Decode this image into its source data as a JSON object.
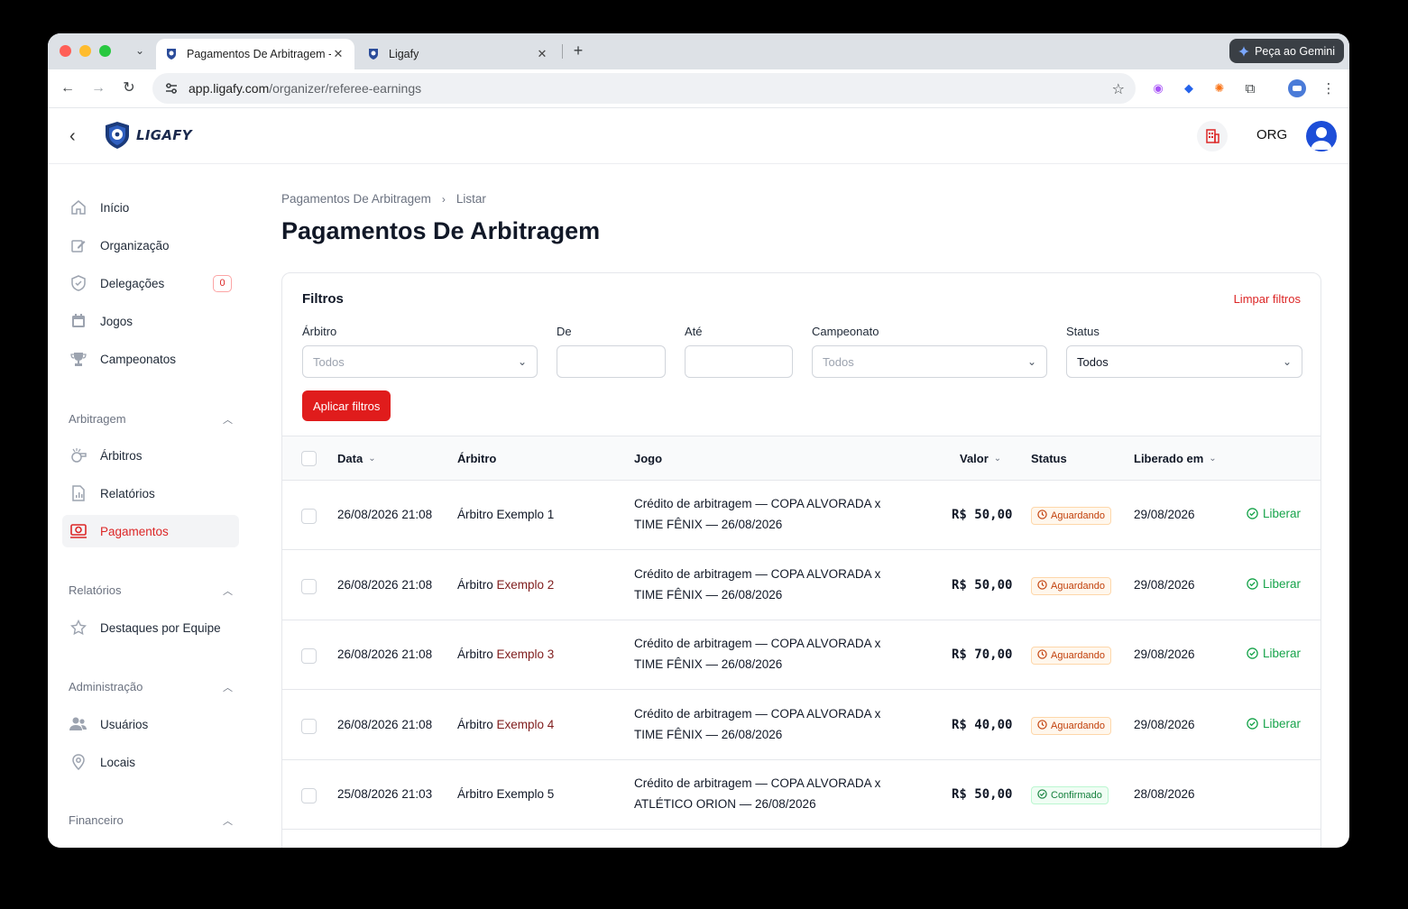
{
  "browser": {
    "tabs": [
      {
        "label": "Pagamentos De Arbitragem -",
        "close": "✕"
      },
      {
        "label": "Ligafy",
        "close": "✕"
      }
    ],
    "new_tab": "+",
    "gemini_label": "Peça ao Gemini",
    "url_host": "app.ligafy.com",
    "url_path": "/organizer/referee-earnings"
  },
  "header": {
    "logo_text": "LIGAFY",
    "org_label": "ORG"
  },
  "sidebar": {
    "items": [
      {
        "label": "Início",
        "icon": "home-icon"
      },
      {
        "label": "Organização",
        "icon": "edit-icon"
      },
      {
        "label": "Delegações",
        "icon": "shield-icon",
        "badge": "0"
      },
      {
        "label": "Jogos",
        "icon": "calendar-icon"
      },
      {
        "label": "Campeonatos",
        "icon": "trophy-icon"
      }
    ],
    "groups": {
      "arbitragem": {
        "label": "Arbitragem",
        "items": [
          {
            "label": "Árbitros",
            "icon": "whistle-icon"
          },
          {
            "label": "Relatórios",
            "icon": "report-icon"
          },
          {
            "label": "Pagamentos",
            "icon": "payments-icon"
          }
        ]
      },
      "relatorios": {
        "label": "Relatórios",
        "items": [
          {
            "label": "Destaques por Equipe",
            "icon": "star-icon"
          }
        ]
      },
      "administracao": {
        "label": "Administração",
        "items": [
          {
            "label": "Usuários",
            "icon": "users-icon"
          },
          {
            "label": "Locais",
            "icon": "location-icon"
          }
        ]
      },
      "financeiro": {
        "label": "Financeiro"
      }
    }
  },
  "page": {
    "breadcrumb": [
      "Pagamentos De Arbitragem",
      "Listar"
    ],
    "title": "Pagamentos De Arbitragem"
  },
  "filters": {
    "title": "Filtros",
    "clear_label": "Limpar filtros",
    "arbitro": {
      "label": "Árbitro",
      "placeholder": "Todos"
    },
    "de": {
      "label": "De",
      "value": ""
    },
    "ate": {
      "label": "Até",
      "value": ""
    },
    "campeonato": {
      "label": "Campeonato",
      "placeholder": "Todos"
    },
    "status": {
      "label": "Status",
      "value": "Todos"
    },
    "apply_label": "Aplicar filtros"
  },
  "table": {
    "columns": [
      "Data",
      "Árbitro",
      "Jogo",
      "Valor",
      "Status",
      "Liberado em"
    ],
    "release_label": "Liberar",
    "rows": [
      {
        "data": "26/08/2026 21:08",
        "arbitro_a": "Árbitro Exemplo 1",
        "arbitro_b": "",
        "jogo_1": "Crédito de arbitragem — COPA ALVORADA x",
        "jogo_2": "TIME FÊNIX — 26/08/2026",
        "valor": "R$ 50,00",
        "status": "Aguardando",
        "status_kind": "wait",
        "liberado": "29/08/2026",
        "liberar": true
      },
      {
        "data": "26/08/2026 21:08",
        "arbitro_a": "Árbitro ",
        "arbitro_b": "Exemplo 2",
        "jogo_1": "Crédito de arbitragem — COPA ALVORADA x",
        "jogo_2": "TIME FÊNIX — 26/08/2026",
        "valor": "R$ 50,00",
        "status": "Aguardando",
        "status_kind": "wait",
        "liberado": "29/08/2026",
        "liberar": true
      },
      {
        "data": "26/08/2026 21:08",
        "arbitro_a": "Árbitro ",
        "arbitro_b": "Exemplo 3",
        "jogo_1": "Crédito de arbitragem — COPA ALVORADA x",
        "jogo_2": "TIME FÊNIX — 26/08/2026",
        "valor": "R$ 70,00",
        "status": "Aguardando",
        "status_kind": "wait",
        "liberado": "29/08/2026",
        "liberar": true
      },
      {
        "data": "26/08/2026 21:08",
        "arbitro_a": "Árbitro ",
        "arbitro_b": "Exemplo 4",
        "jogo_1": "Crédito de arbitragem — COPA ALVORADA x",
        "jogo_2": "TIME FÊNIX — 26/08/2026",
        "valor": "R$ 40,00",
        "status": "Aguardando",
        "status_kind": "wait",
        "liberado": "29/08/2026",
        "liberar": true
      },
      {
        "data": "25/08/2026 21:03",
        "arbitro_a": "Árbitro Exemplo 5",
        "arbitro_b": "",
        "jogo_1": "Crédito de arbitragem — COPA ALVORADA x",
        "jogo_2": "ATLÉTICO ORION — 26/08/2026",
        "valor": "R$ 50,00",
        "status": "Confirmado",
        "status_kind": "ok",
        "liberado": "28/08/2026",
        "liberar": false
      }
    ]
  },
  "colors": {
    "accent": "#dc2626",
    "button": "#e01c1c",
    "waiting": "#c2410c",
    "confirmed": "#15803d"
  }
}
